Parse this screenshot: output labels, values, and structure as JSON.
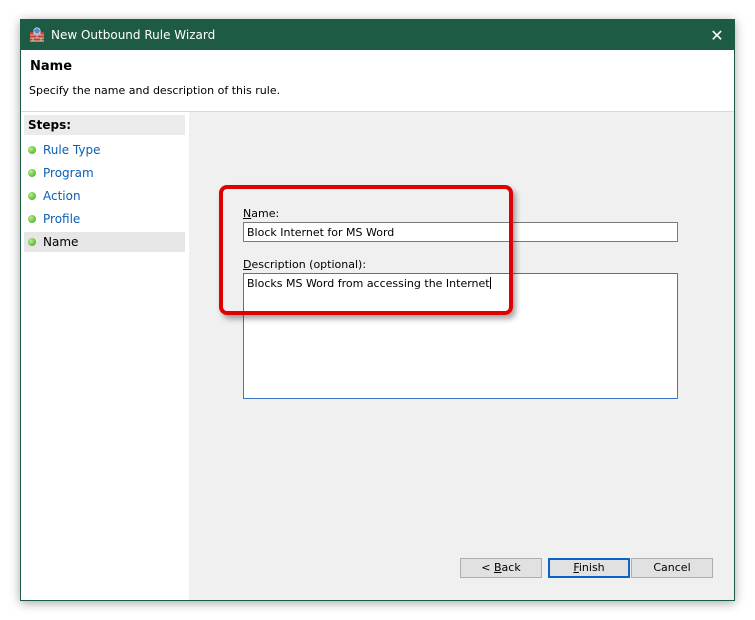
{
  "window": {
    "title": "New Outbound Rule Wizard"
  },
  "header": {
    "title": "Name",
    "subtitle": "Specify the name and description of this rule."
  },
  "steps": {
    "title": "Steps:",
    "items": [
      {
        "label": "Rule Type",
        "state": "completed"
      },
      {
        "label": "Program",
        "state": "completed"
      },
      {
        "label": "Action",
        "state": "completed"
      },
      {
        "label": "Profile",
        "state": "completed"
      },
      {
        "label": "Name",
        "state": "current"
      }
    ]
  },
  "form": {
    "name_label_accel": "N",
    "name_label_rest": "ame:",
    "name_value": "Block Internet for MS Word",
    "desc_label_accel": "D",
    "desc_label_rest": "escription (optional):",
    "desc_value": "Blocks MS Word from accessing the Internet"
  },
  "buttons": {
    "back_prefix": "< ",
    "back_accel": "B",
    "back_rest": "ack",
    "finish_accel": "F",
    "finish_rest": "inish",
    "cancel": "Cancel"
  },
  "colors": {
    "titlebar": "#1e5b45",
    "highlight": "#e00000",
    "link": "#0a5fb5",
    "step_dot": "#34a01a"
  }
}
